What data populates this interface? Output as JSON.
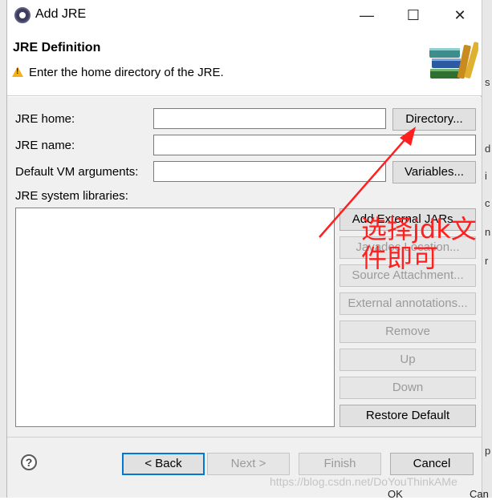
{
  "window": {
    "title": "Add JRE",
    "minimize": "—",
    "maximize": "☐",
    "close": "✕"
  },
  "header": {
    "title": "JRE Definition",
    "message": "Enter the home directory of the JRE."
  },
  "form": {
    "jre_home_label": "JRE home:",
    "jre_home_value": "",
    "directory_button": "Directory...",
    "jre_name_label": "JRE name:",
    "jre_name_value": "",
    "vm_args_label": "Default VM arguments:",
    "vm_args_value": "",
    "variables_button": "Variables...",
    "libraries_label": "JRE system libraries:"
  },
  "library_buttons": [
    "Add External JARs...",
    "Javadoc Location...",
    "Source Attachment...",
    "External annotations...",
    "Remove",
    "Up",
    "Down",
    "Restore Default"
  ],
  "footer": {
    "back": "< Back",
    "next": "Next >",
    "finish": "Finish",
    "cancel": "Cancel",
    "help": "?"
  },
  "annotation": {
    "text_line1": "选择jdk文",
    "text_line2": "件即可",
    "color": "#ff1f1f"
  },
  "watermark": "https://blog.csdn.net/DoYouThinkAMe",
  "background_fragments": {
    "ok": "OK",
    "can": "Can"
  }
}
